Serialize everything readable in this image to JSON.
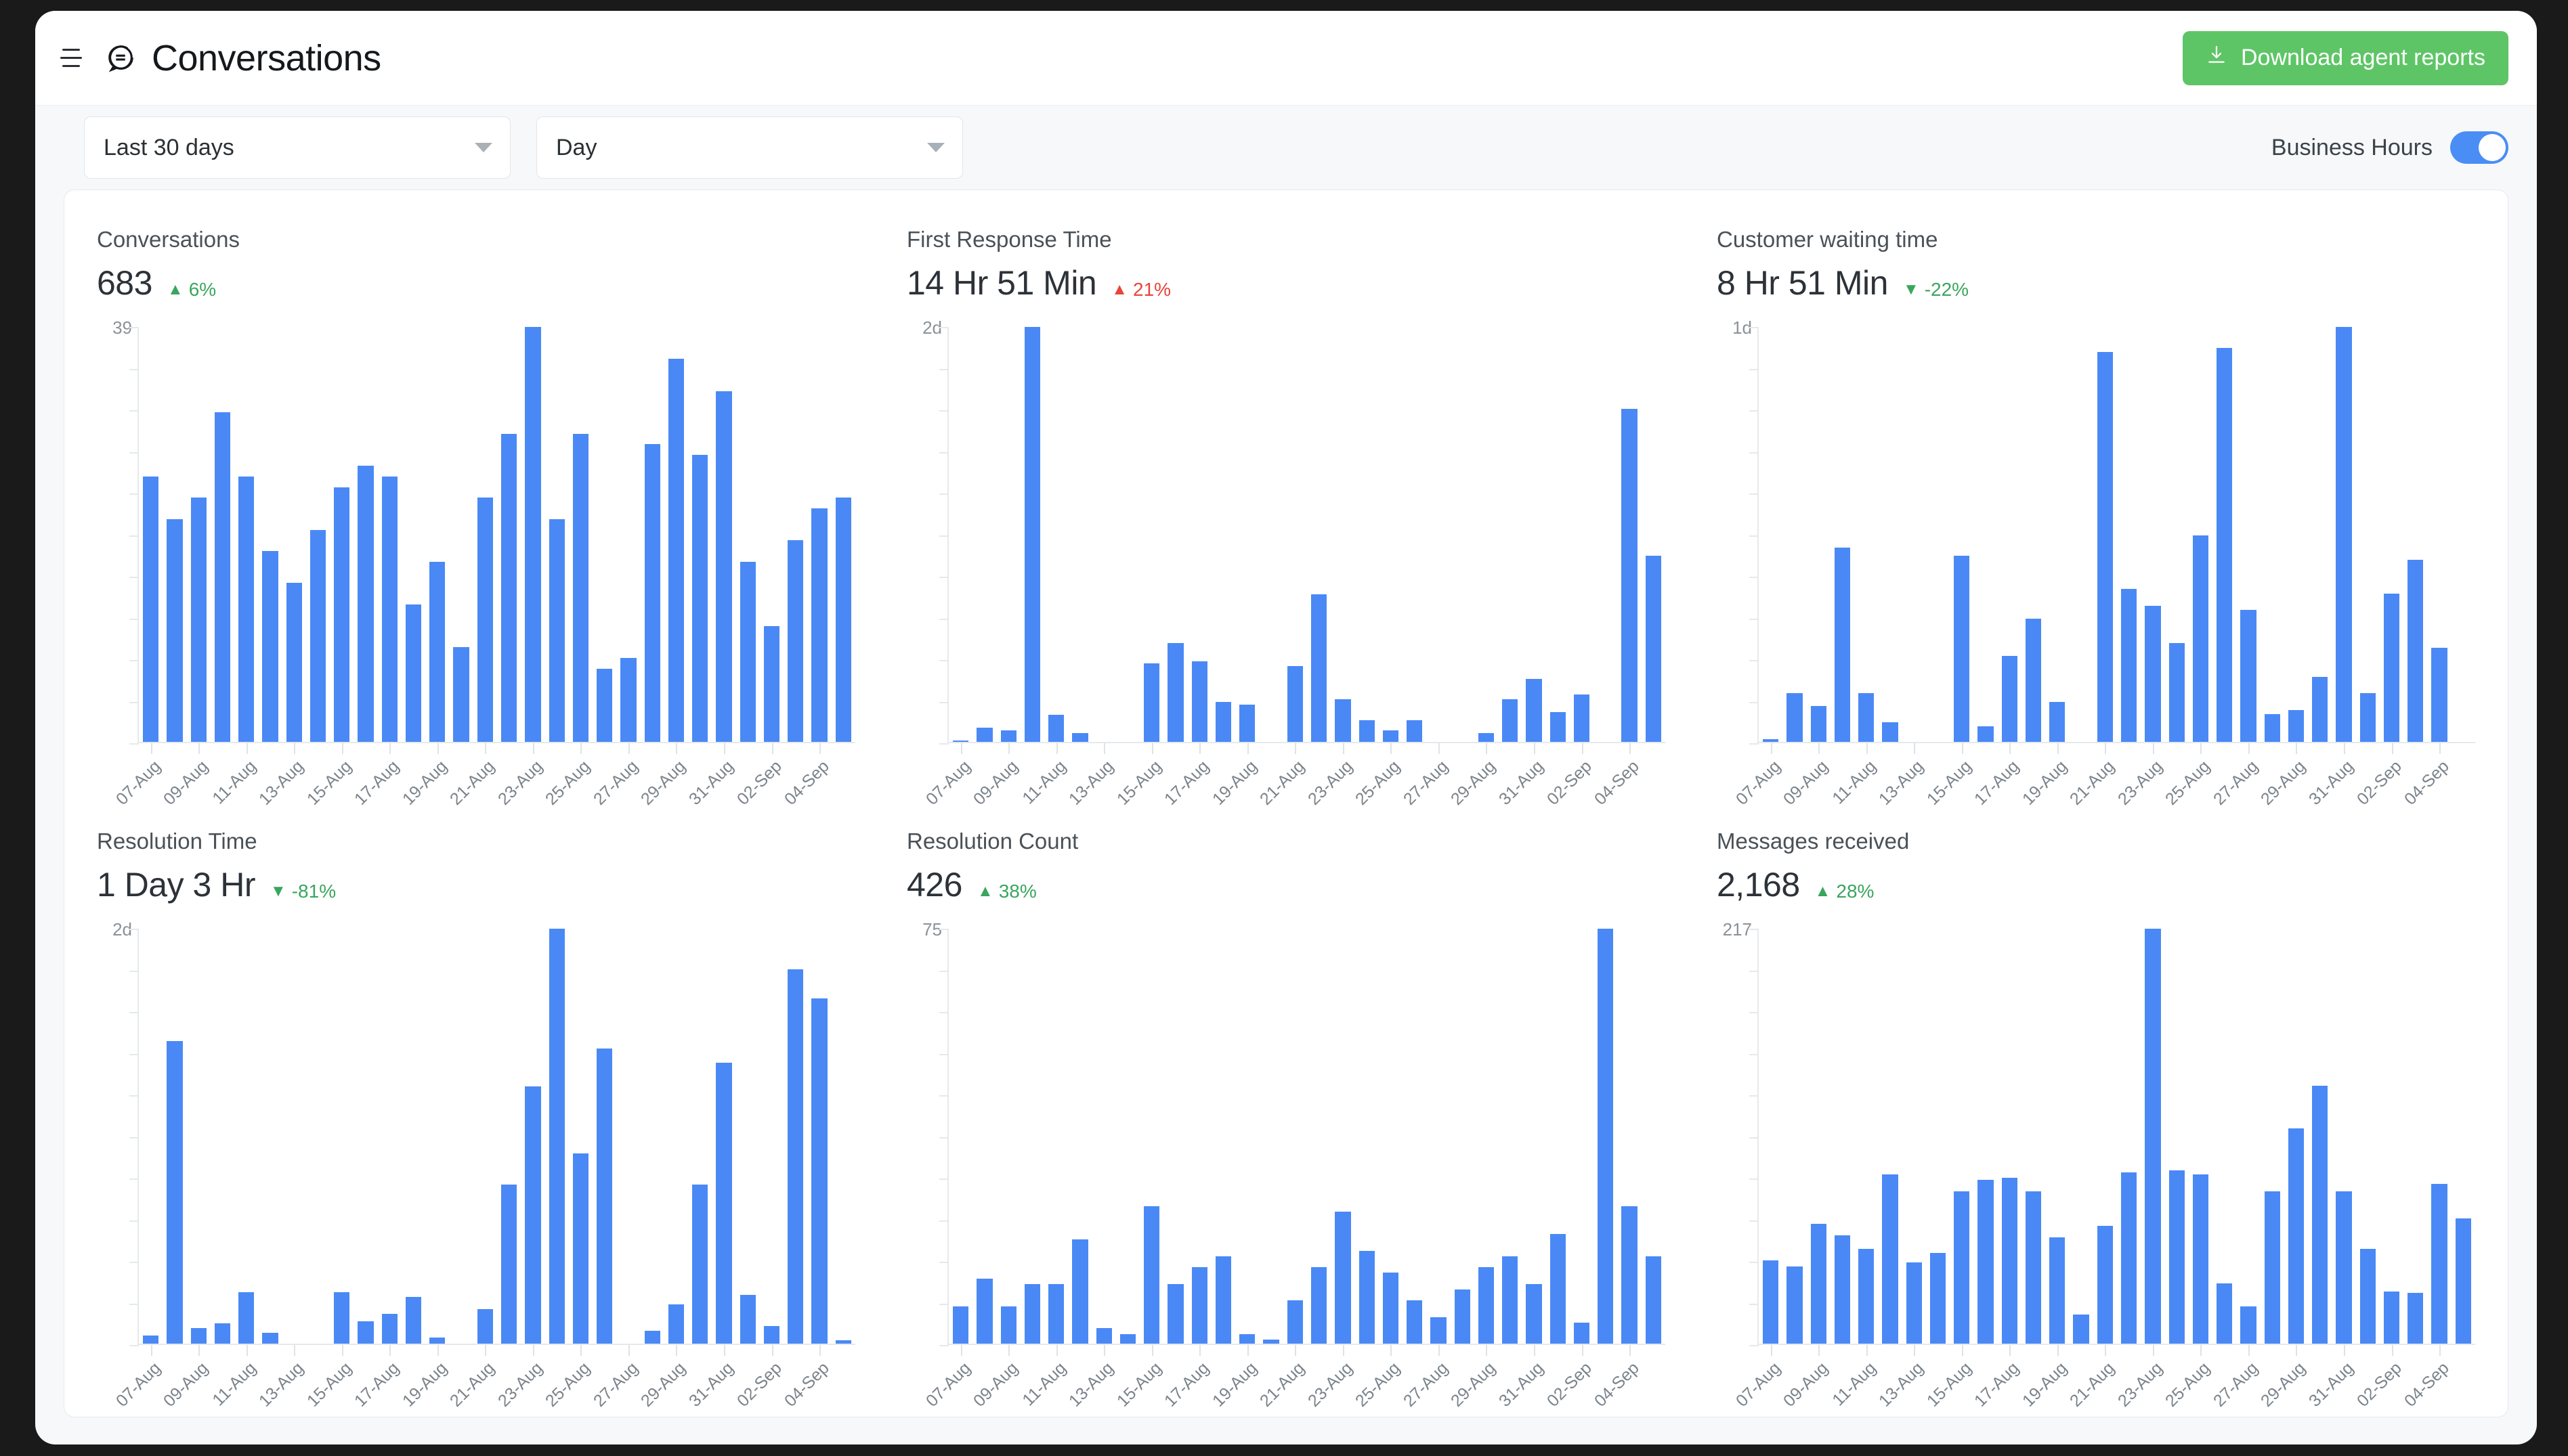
{
  "header": {
    "menu_icon": "hamburger-icon",
    "app_icon": "chat-bubble-icon",
    "title": "Conversations",
    "download_icon": "download-icon",
    "download_label": "Download agent reports",
    "download_color": "#5ec566"
  },
  "filters": {
    "date_range": {
      "value": "Last 30 days",
      "caret_icon": "chevron-down-icon"
    },
    "granularity": {
      "value": "Day",
      "caret_icon": "chevron-down-icon"
    },
    "business_hours": {
      "label": "Business Hours",
      "enabled": true,
      "accent": "#4a8ef5"
    }
  },
  "theme": {
    "bar_color": "#4a89f5",
    "positive_color": "#3aa55e",
    "negative_color": "#e8443c",
    "card_bg": "#ffffff",
    "page_bg": "#f6f8fa"
  },
  "categories": [
    "07-Aug",
    "08-Aug",
    "09-Aug",
    "10-Aug",
    "11-Aug",
    "12-Aug",
    "13-Aug",
    "14-Aug",
    "15-Aug",
    "16-Aug",
    "17-Aug",
    "18-Aug",
    "19-Aug",
    "20-Aug",
    "21-Aug",
    "22-Aug",
    "23-Aug",
    "24-Aug",
    "25-Aug",
    "26-Aug",
    "27-Aug",
    "28-Aug",
    "29-Aug",
    "30-Aug",
    "31-Aug",
    "01-Sep",
    "02-Sep",
    "03-Sep",
    "04-Sep",
    "05-Sep"
  ],
  "tick_labels": [
    "07-Aug",
    "",
    "09-Aug",
    "",
    "11-Aug",
    "",
    "13-Aug",
    "",
    "15-Aug",
    "",
    "17-Aug",
    "",
    "19-Aug",
    "",
    "21-Aug",
    "",
    "23-Aug",
    "",
    "25-Aug",
    "",
    "27-Aug",
    "",
    "29-Aug",
    "",
    "31-Aug",
    "",
    "02-Sep",
    "",
    "04-Sep",
    ""
  ],
  "cards": [
    {
      "id": "conversations",
      "title": "Conversations",
      "value": "683",
      "delta": "6%",
      "delta_dir": "up",
      "delta_tone": "positive",
      "y_max_label": "39"
    },
    {
      "id": "first-response-time",
      "title": "First Response Time",
      "value": "14 Hr 51 Min",
      "delta": "21%",
      "delta_dir": "up",
      "delta_tone": "negative",
      "y_max_label": "2d"
    },
    {
      "id": "customer-waiting-time",
      "title": "Customer waiting time",
      "value": "8 Hr 51 Min",
      "delta": "-22%",
      "delta_dir": "down",
      "delta_tone": "positive",
      "y_max_label": "1d"
    },
    {
      "id": "resolution-time",
      "title": "Resolution Time",
      "value": "1 Day 3 Hr",
      "delta": "-81%",
      "delta_dir": "down",
      "delta_tone": "positive",
      "y_max_label": "2d"
    },
    {
      "id": "resolution-count",
      "title": "Resolution Count",
      "value": "426",
      "delta": "38%",
      "delta_dir": "up",
      "delta_tone": "positive",
      "y_max_label": "75"
    },
    {
      "id": "messages-received",
      "title": "Messages received",
      "value": "2,168",
      "delta": "28%",
      "delta_dir": "up",
      "delta_tone": "positive",
      "y_max_label": "217"
    }
  ],
  "chart_data": [
    {
      "type": "bar",
      "title": "Conversations",
      "xlabel": "",
      "ylabel": "",
      "ylim": [
        0,
        39
      ],
      "grid": false,
      "legend": "none",
      "categories": [
        "07-Aug",
        "08-Aug",
        "09-Aug",
        "10-Aug",
        "11-Aug",
        "12-Aug",
        "13-Aug",
        "14-Aug",
        "15-Aug",
        "16-Aug",
        "17-Aug",
        "18-Aug",
        "19-Aug",
        "20-Aug",
        "21-Aug",
        "22-Aug",
        "23-Aug",
        "24-Aug",
        "25-Aug",
        "26-Aug",
        "27-Aug",
        "28-Aug",
        "29-Aug",
        "30-Aug",
        "31-Aug",
        "01-Sep",
        "02-Sep",
        "03-Sep",
        "04-Sep",
        "05-Sep"
      ],
      "values": [
        25,
        21,
        23,
        31,
        25,
        18,
        15,
        20,
        24,
        26,
        25,
        13,
        17,
        9,
        23,
        29,
        39,
        21,
        29,
        7,
        8,
        28,
        36,
        27,
        33,
        17,
        11,
        19,
        22,
        23
      ]
    },
    {
      "type": "bar",
      "title": "First Response Time",
      "xlabel": "",
      "ylabel": "",
      "ylim": [
        0,
        2
      ],
      "grid": false,
      "legend": "none",
      "categories": [
        "07-Aug",
        "08-Aug",
        "09-Aug",
        "10-Aug",
        "11-Aug",
        "12-Aug",
        "13-Aug",
        "14-Aug",
        "15-Aug",
        "16-Aug",
        "17-Aug",
        "18-Aug",
        "19-Aug",
        "20-Aug",
        "21-Aug",
        "22-Aug",
        "23-Aug",
        "24-Aug",
        "25-Aug",
        "26-Aug",
        "27-Aug",
        "28-Aug",
        "29-Aug",
        "30-Aug",
        "31-Aug",
        "01-Sep",
        "02-Sep",
        "03-Sep",
        "04-Sep",
        "05-Sep"
      ],
      "values": [
        0.01,
        0.06,
        0.05,
        1.62,
        0.11,
        0.04,
        0.0,
        0.0,
        0.31,
        0.39,
        0.32,
        0.16,
        0.15,
        0.0,
        0.3,
        0.58,
        0.17,
        0.09,
        0.05,
        0.09,
        0.0,
        0.0,
        0.04,
        0.17,
        0.25,
        0.12,
        0.19,
        0.0,
        1.3,
        0.73
      ]
    },
    {
      "type": "bar",
      "title": "Customer waiting time",
      "xlabel": "",
      "ylabel": "",
      "ylim": [
        0,
        1
      ],
      "grid": false,
      "legend": "none",
      "categories": [
        "07-Aug",
        "08-Aug",
        "09-Aug",
        "10-Aug",
        "11-Aug",
        "12-Aug",
        "13-Aug",
        "14-Aug",
        "15-Aug",
        "16-Aug",
        "17-Aug",
        "18-Aug",
        "19-Aug",
        "20-Aug",
        "21-Aug",
        "22-Aug",
        "23-Aug",
        "24-Aug",
        "25-Aug",
        "26-Aug",
        "27-Aug",
        "28-Aug",
        "29-Aug",
        "30-Aug",
        "31-Aug",
        "01-Sep",
        "02-Sep",
        "03-Sep",
        "04-Sep",
        "05-Sep"
      ],
      "values": [
        0.01,
        0.12,
        0.09,
        0.47,
        0.12,
        0.05,
        0.0,
        0.0,
        0.45,
        0.04,
        0.21,
        0.3,
        0.1,
        0.0,
        0.94,
        0.37,
        0.33,
        0.24,
        0.5,
        0.95,
        0.32,
        0.07,
        0.08,
        0.16,
        1.0,
        0.12,
        0.36,
        0.44,
        0.23,
        0.0
      ]
    },
    {
      "type": "bar",
      "title": "Resolution Time",
      "xlabel": "",
      "ylabel": "",
      "ylim": [
        0,
        2
      ],
      "grid": false,
      "legend": "none",
      "categories": [
        "07-Aug",
        "08-Aug",
        "09-Aug",
        "10-Aug",
        "11-Aug",
        "12-Aug",
        "13-Aug",
        "14-Aug",
        "15-Aug",
        "16-Aug",
        "17-Aug",
        "18-Aug",
        "19-Aug",
        "20-Aug",
        "21-Aug",
        "22-Aug",
        "23-Aug",
        "24-Aug",
        "25-Aug",
        "26-Aug",
        "27-Aug",
        "28-Aug",
        "29-Aug",
        "30-Aug",
        "31-Aug",
        "01-Sep",
        "02-Sep",
        "03-Sep",
        "04-Sep",
        "05-Sep"
      ],
      "values": [
        0.04,
        1.27,
        0.07,
        0.09,
        0.22,
        0.05,
        0.0,
        0.0,
        0.22,
        0.1,
        0.13,
        0.2,
        0.03,
        0.0,
        0.15,
        0.67,
        1.08,
        1.74,
        0.8,
        1.24,
        0.0,
        0.06,
        0.17,
        0.67,
        1.18,
        0.21,
        0.08,
        1.57,
        1.45,
        0.02
      ]
    },
    {
      "type": "bar",
      "title": "Resolution Count",
      "xlabel": "",
      "ylabel": "",
      "ylim": [
        0,
        75
      ],
      "grid": false,
      "legend": "none",
      "categories": [
        "07-Aug",
        "08-Aug",
        "09-Aug",
        "10-Aug",
        "11-Aug",
        "12-Aug",
        "13-Aug",
        "14-Aug",
        "15-Aug",
        "16-Aug",
        "17-Aug",
        "18-Aug",
        "19-Aug",
        "20-Aug",
        "21-Aug",
        "22-Aug",
        "23-Aug",
        "24-Aug",
        "25-Aug",
        "26-Aug",
        "27-Aug",
        "28-Aug",
        "29-Aug",
        "30-Aug",
        "31-Aug",
        "01-Sep",
        "02-Sep",
        "03-Sep",
        "04-Sep",
        "05-Sep"
      ],
      "values": [
        7,
        12,
        7,
        11,
        11,
        19,
        3,
        2,
        25,
        11,
        14,
        16,
        2,
        1,
        8,
        14,
        24,
        17,
        13,
        8,
        5,
        10,
        14,
        16,
        11,
        20,
        4,
        75,
        25,
        16
      ]
    },
    {
      "type": "bar",
      "title": "Messages received",
      "xlabel": "",
      "ylabel": "",
      "ylim": [
        0,
        217
      ],
      "grid": false,
      "legend": "none",
      "categories": [
        "07-Aug",
        "08-Aug",
        "09-Aug",
        "10-Aug",
        "11-Aug",
        "12-Aug",
        "13-Aug",
        "14-Aug",
        "15-Aug",
        "16-Aug",
        "17-Aug",
        "18-Aug",
        "19-Aug",
        "20-Aug",
        "21-Aug",
        "22-Aug",
        "23-Aug",
        "24-Aug",
        "25-Aug",
        "26-Aug",
        "27-Aug",
        "28-Aug",
        "29-Aug",
        "30-Aug",
        "31-Aug",
        "01-Sep",
        "02-Sep",
        "03-Sep",
        "04-Sep",
        "05-Sep"
      ],
      "values": [
        44,
        41,
        63,
        57,
        50,
        89,
        43,
        48,
        80,
        86,
        87,
        80,
        56,
        16,
        62,
        90,
        217,
        91,
        89,
        32,
        20,
        80,
        113,
        135,
        80,
        50,
        28,
        27,
        84,
        66
      ]
    }
  ]
}
